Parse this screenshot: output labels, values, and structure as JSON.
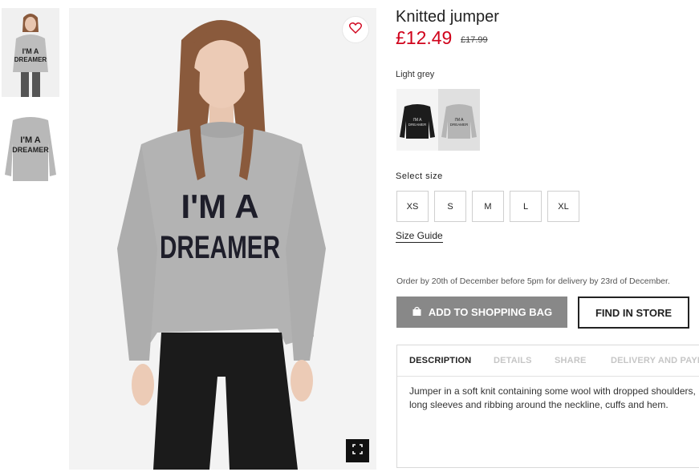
{
  "product": {
    "title": "Knitted jumper",
    "price": "£12.49",
    "old_price": "£17.99",
    "color_name": "Light grey"
  },
  "thumbnails": [
    {
      "label": "I'M A DREAMER",
      "alt": "model wearing jumper"
    },
    {
      "label": "I'M A DREAMER",
      "alt": "jumper flat"
    }
  ],
  "main_image": {
    "print_line1": "I'M A",
    "print_line2": "DREAMER"
  },
  "swatches": [
    {
      "name": "black",
      "print": "I'M A DREAMER",
      "color": "#1c1c1c"
    },
    {
      "name": "light-grey",
      "print": "I'M A DREAMER",
      "color": "#b5b5b5"
    }
  ],
  "sizes": {
    "heading": "Select size",
    "options": [
      "XS",
      "S",
      "M",
      "L",
      "XL"
    ]
  },
  "size_guide": "Size Guide",
  "delivery_note": "Order by 20th of December before 5pm for delivery by 23rd of December.",
  "buttons": {
    "add_to_bag": "ADD TO SHOPPING BAG",
    "find_in_store": "FIND IN STORE"
  },
  "tabs": [
    {
      "label": "DESCRIPTION",
      "active": true
    },
    {
      "label": "DETAILS"
    },
    {
      "label": "SHARE"
    },
    {
      "label": "DELIVERY AND PAYMENT"
    }
  ],
  "description": "Jumper in a soft knit containing some wool with dropped shoulders, long sleeves and ribbing around the neckline, cuffs and hem.",
  "icons": {
    "favorite": "heart-icon",
    "expand": "fullscreen-icon",
    "bag": "shopping-bag-icon"
  },
  "colors": {
    "price_red": "#d0021b",
    "button_grey": "#888888"
  }
}
